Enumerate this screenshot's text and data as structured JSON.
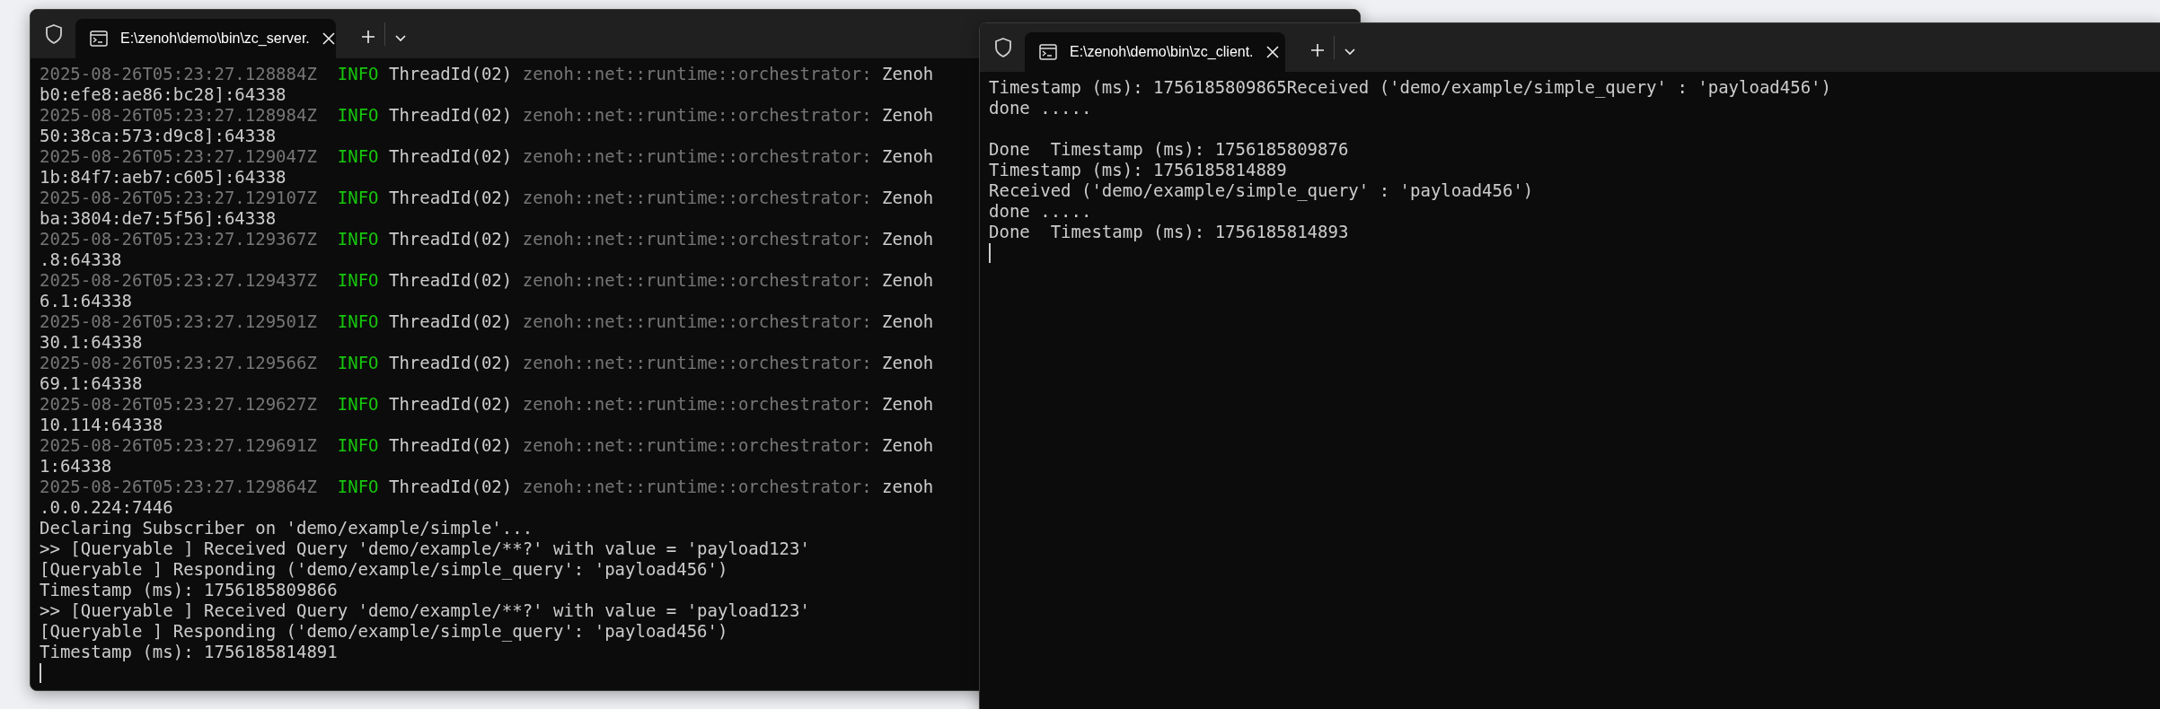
{
  "windows": [
    {
      "tab": {
        "title": "E:\\zenoh\\demo\\bin\\zc_server.",
        "selected": true
      },
      "log_entries": [
        {
          "timestamp": "2025-08-26T05:23:27.128884Z",
          "level": "INFO",
          "thread": "ThreadId(02)",
          "target": "zenoh::net::runtime::orchestrator:",
          "message": "Zenoh",
          "continuation": "b0:efe8:ae86:bc28]:64338"
        },
        {
          "timestamp": "2025-08-26T05:23:27.128984Z",
          "level": "INFO",
          "thread": "ThreadId(02)",
          "target": "zenoh::net::runtime::orchestrator:",
          "message": "Zenoh",
          "continuation": "50:38ca:573:d9c8]:64338"
        },
        {
          "timestamp": "2025-08-26T05:23:27.129047Z",
          "level": "INFO",
          "thread": "ThreadId(02)",
          "target": "zenoh::net::runtime::orchestrator:",
          "message": "Zenoh",
          "continuation": "1b:84f7:aeb7:c605]:64338"
        },
        {
          "timestamp": "2025-08-26T05:23:27.129107Z",
          "level": "INFO",
          "thread": "ThreadId(02)",
          "target": "zenoh::net::runtime::orchestrator:",
          "message": "Zenoh",
          "continuation": "ba:3804:de7:5f56]:64338"
        },
        {
          "timestamp": "2025-08-26T05:23:27.129367Z",
          "level": "INFO",
          "thread": "ThreadId(02)",
          "target": "zenoh::net::runtime::orchestrator:",
          "message": "Zenoh",
          "continuation": ".8:64338"
        },
        {
          "timestamp": "2025-08-26T05:23:27.129437Z",
          "level": "INFO",
          "thread": "ThreadId(02)",
          "target": "zenoh::net::runtime::orchestrator:",
          "message": "Zenoh",
          "continuation": "6.1:64338"
        },
        {
          "timestamp": "2025-08-26T05:23:27.129501Z",
          "level": "INFO",
          "thread": "ThreadId(02)",
          "target": "zenoh::net::runtime::orchestrator:",
          "message": "Zenoh",
          "continuation": "30.1:64338"
        },
        {
          "timestamp": "2025-08-26T05:23:27.129566Z",
          "level": "INFO",
          "thread": "ThreadId(02)",
          "target": "zenoh::net::runtime::orchestrator:",
          "message": "Zenoh",
          "continuation": "69.1:64338"
        },
        {
          "timestamp": "2025-08-26T05:23:27.129627Z",
          "level": "INFO",
          "thread": "ThreadId(02)",
          "target": "zenoh::net::runtime::orchestrator:",
          "message": "Zenoh",
          "continuation": "10.114:64338"
        },
        {
          "timestamp": "2025-08-26T05:23:27.129691Z",
          "level": "INFO",
          "thread": "ThreadId(02)",
          "target": "zenoh::net::runtime::orchestrator:",
          "message": "Zenoh",
          "continuation": "1:64338"
        },
        {
          "timestamp": "2025-08-26T05:23:27.129864Z",
          "level": "INFO",
          "thread": "ThreadId(02)",
          "target": "zenoh::net::runtime::orchestrator:",
          "message": "zenoh",
          "continuation": ".0.0.224:7446"
        }
      ],
      "lines": [
        {
          "kind": "text",
          "text": "Declaring Subscriber on 'demo/example/simple'..."
        },
        {
          "kind": "text",
          "text": ">> [Queryable ] Received Query 'demo/example/**?' with value = 'payload123'"
        },
        {
          "kind": "text",
          "text": "[Queryable ] Responding ('demo/example/simple_query': 'payload456')"
        },
        {
          "kind": "text",
          "text": "Timestamp (ms): 1756185809866"
        },
        {
          "kind": "text",
          "text": ">> [Queryable ] Received Query 'demo/example/**?' with value = 'payload123'"
        },
        {
          "kind": "text",
          "text": "[Queryable ] Responding ('demo/example/simple_query': 'payload456')"
        },
        {
          "kind": "text",
          "text": "Timestamp (ms): 1756185814891"
        }
      ]
    },
    {
      "tab": {
        "title": "E:\\zenoh\\demo\\bin\\zc_client.",
        "selected": true
      },
      "lines": [
        {
          "kind": "text",
          "text": "Timestamp (ms): 1756185809865Received ('demo/example/simple_query' : 'payload456')"
        },
        {
          "kind": "text",
          "text": "done ....."
        },
        {
          "kind": "blank"
        },
        {
          "kind": "text",
          "text": "Done  Timestamp (ms): 1756185809876"
        },
        {
          "kind": "text",
          "text": "Timestamp (ms): 1756185814889"
        },
        {
          "kind": "text",
          "text": "Received ('demo/example/simple_query' : 'payload456')"
        },
        {
          "kind": "text",
          "text": "done ....."
        },
        {
          "kind": "text",
          "text": "Done  Timestamp (ms): 1756185814893"
        }
      ]
    }
  ]
}
